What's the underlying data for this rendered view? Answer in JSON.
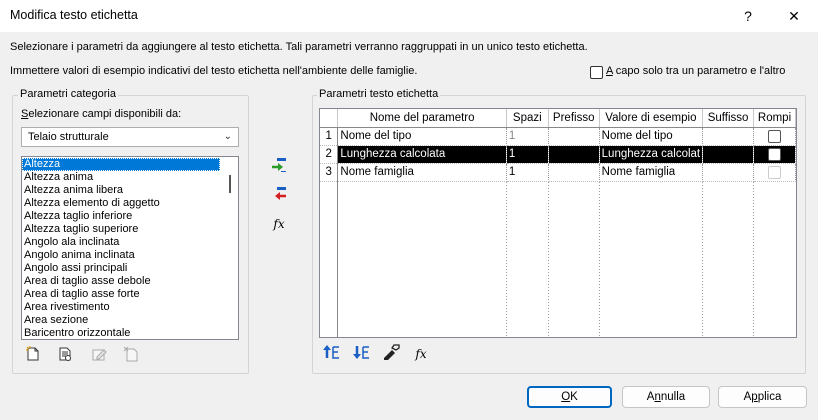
{
  "window": {
    "title": "Modifica testo etichetta",
    "help_glyph": "?",
    "close_glyph": "✕"
  },
  "instructions": {
    "line1": "Selezionare i parametri da aggiungere al testo etichetta. Tali parametri verranno raggruppati in un unico testo etichetta.",
    "line2": "Immettere valori di esempio indicativi del testo etichetta nell'ambiente delle famiglie."
  },
  "wrap_option": {
    "label_prefix": "",
    "label_accel": "A",
    "label_rest": " capo solo tra un parametro e l'altro",
    "checked": false
  },
  "category_params": {
    "group_label": "Parametri categoria",
    "select_label_accel": "S",
    "select_label_rest": "elezionare campi disponibili da:",
    "combo_value": "Telaio strutturale",
    "items": [
      "Altezza",
      "Altezza anima",
      "Altezza anima libera",
      "Altezza elemento di aggetto",
      "Altezza taglio inferiore",
      "Altezza taglio superiore",
      "Angolo ala inclinata",
      "Angolo anima inclinata",
      "Angolo assi principali",
      "Area di taglio asse debole",
      "Area di taglio asse forte",
      "Area rivestimento",
      "Area sezione",
      "Baricentro orizzontale"
    ],
    "selected_index": 0
  },
  "icons": {
    "add_param": "add-parameter-icon",
    "remove_param": "remove-parameter-icon",
    "fx": "fx"
  },
  "label_params": {
    "group_label": "Parametri testo etichetta",
    "columns": [
      "",
      "Nome del parametro",
      "Spazi",
      "Prefisso",
      "Valore di esempio",
      "Suffisso",
      "Rompi"
    ],
    "rows": [
      {
        "num": "1",
        "name": "Nome del tipo",
        "spaces": "1",
        "prefix": "",
        "sample": "Nome del tipo",
        "suffix": "",
        "break": false,
        "spaces_gray": true
      },
      {
        "num": "2",
        "name": "Lunghezza calcolata",
        "spaces": "1",
        "prefix": "",
        "sample": "Lunghezza calcolat",
        "suffix": "",
        "break": false,
        "spaces_gray": false
      },
      {
        "num": "3",
        "name": "Nome famiglia",
        "spaces": "1",
        "prefix": "",
        "sample": "Nome famiglia",
        "suffix": "",
        "break": false,
        "spaces_gray": false
      }
    ],
    "selected_row": 1
  },
  "fx_glyph": "fx",
  "buttons": {
    "ok_accel": "O",
    "ok_rest": "K",
    "cancel_prefix": "A",
    "cancel_accel": "n",
    "cancel_rest": "nulla",
    "apply_prefix": "A",
    "apply_accel": "p",
    "apply_rest": "plica"
  },
  "colors": {
    "selection_blue": "#0078d7",
    "default_button_border": "#0067c0",
    "add_arrow_green": "#2a9a2a",
    "remove_arrow_red": "#d42020",
    "move_arrow_blue": "#1a5fc4"
  }
}
